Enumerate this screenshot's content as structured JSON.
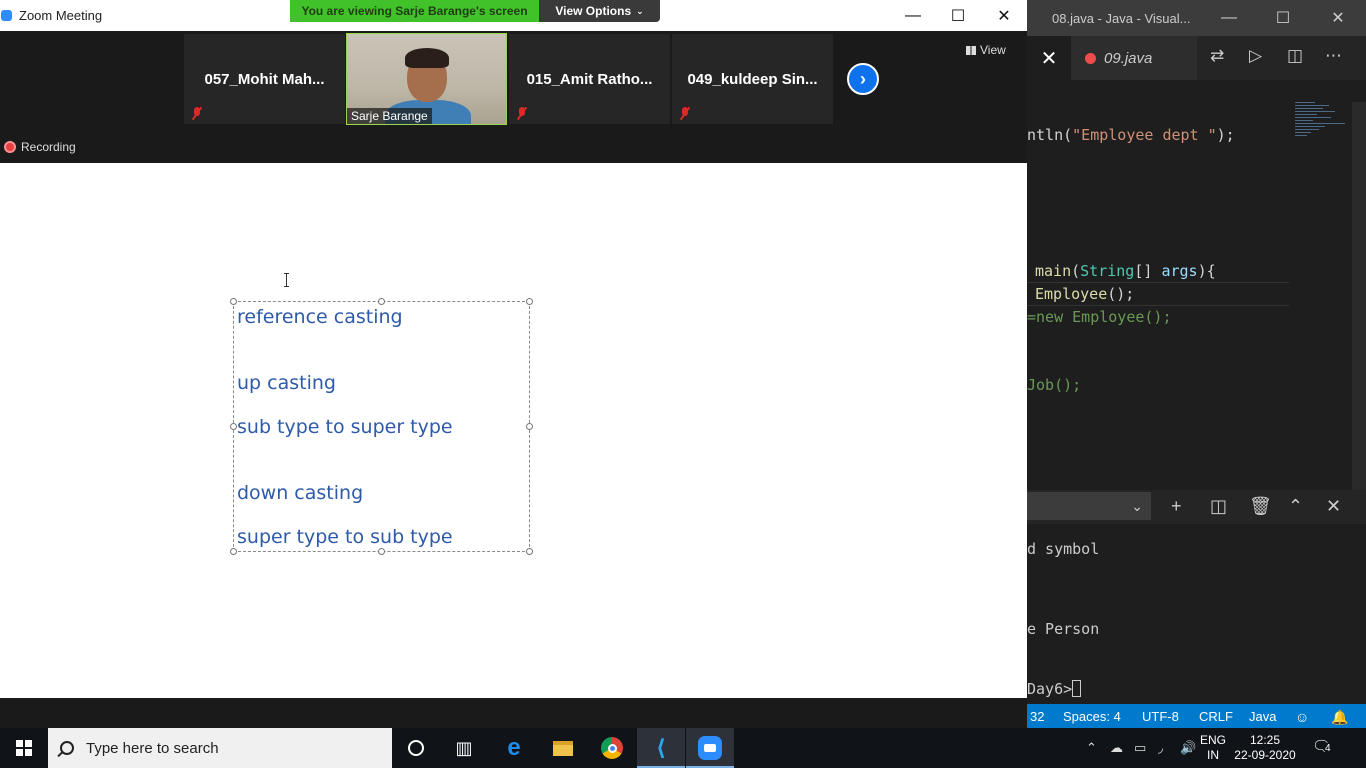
{
  "zoom": {
    "window_title": "Zoom Meeting",
    "share_banner": "You are viewing Sarje Barange's screen",
    "view_options": "View Options",
    "view_label": "View",
    "recording_label": "Recording",
    "participants": [
      {
        "name": "057_Mohit  Mah...",
        "muted": true
      },
      {
        "name": "Sarje Barange",
        "muted": false,
        "video": true
      },
      {
        "name": "015_Amit  Ratho...",
        "muted": true
      },
      {
        "name": "049_kuldeep  Sin...",
        "muted": true
      }
    ],
    "shared_text": [
      "reference casting",
      "up casting",
      "sub type to super type",
      "down casting",
      "super type to sub type"
    ]
  },
  "vscode": {
    "window_title": "08.java - Java - Visual...",
    "tab_label": "09.java",
    "code_lines": {
      "l1_pre": "ntln(",
      "l1_str": "\"Employee dept \"",
      "l1_post": ");",
      "l2_fn": "main",
      "l2_open": "(",
      "l2_type": "String",
      "l2_mid": "[] ",
      "l2_var": "args",
      "l2_close": "){",
      "l3_fn": "Employee",
      "l3_rest": "();",
      "l4": "=new Employee();",
      "l5": "Job();"
    },
    "terminal_lines": [
      "d symbol",
      "e Person",
      "Day6>"
    ],
    "status_items": [
      "32",
      "Spaces: 4",
      "UTF-8",
      "CRLF",
      "Java"
    ]
  },
  "taskbar": {
    "search_placeholder": "Type here to search",
    "lang_top": "ENG",
    "lang_bottom": "IN",
    "time": "12:25",
    "date": "22-09-2020",
    "notification_count": "4"
  }
}
